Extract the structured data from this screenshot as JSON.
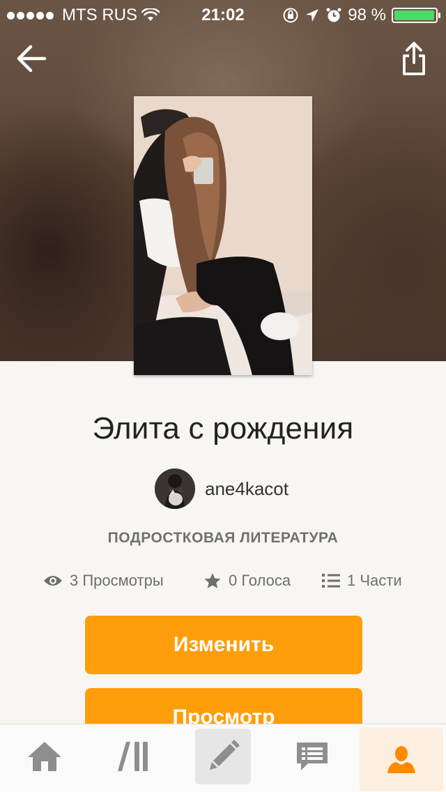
{
  "status_bar": {
    "carrier": "MTS RUS",
    "time": "21:02",
    "battery_percent": "98 %",
    "battery_level": 0.98
  },
  "nav": {
    "back_icon": "arrow-left-icon",
    "share_icon": "share-icon"
  },
  "story": {
    "title": "Элита с рождения",
    "author": "ane4kacot",
    "category": "ПОДРОСТКОВАЯ ЛИТЕРАТУРА",
    "stats": {
      "views": "3 Просмотры",
      "votes": "0 Голоса",
      "parts": "1 Части"
    }
  },
  "actions": {
    "edit_label": "Изменить",
    "preview_label": "Просмотр"
  },
  "tabbar": {
    "items": [
      "home-icon",
      "library-icon",
      "write-icon",
      "messages-icon",
      "profile-icon"
    ],
    "active": "profile-icon"
  },
  "colors": {
    "accent": "#ff9d0a",
    "active_tab": "#ff8a00",
    "battery": "#4cd964"
  }
}
